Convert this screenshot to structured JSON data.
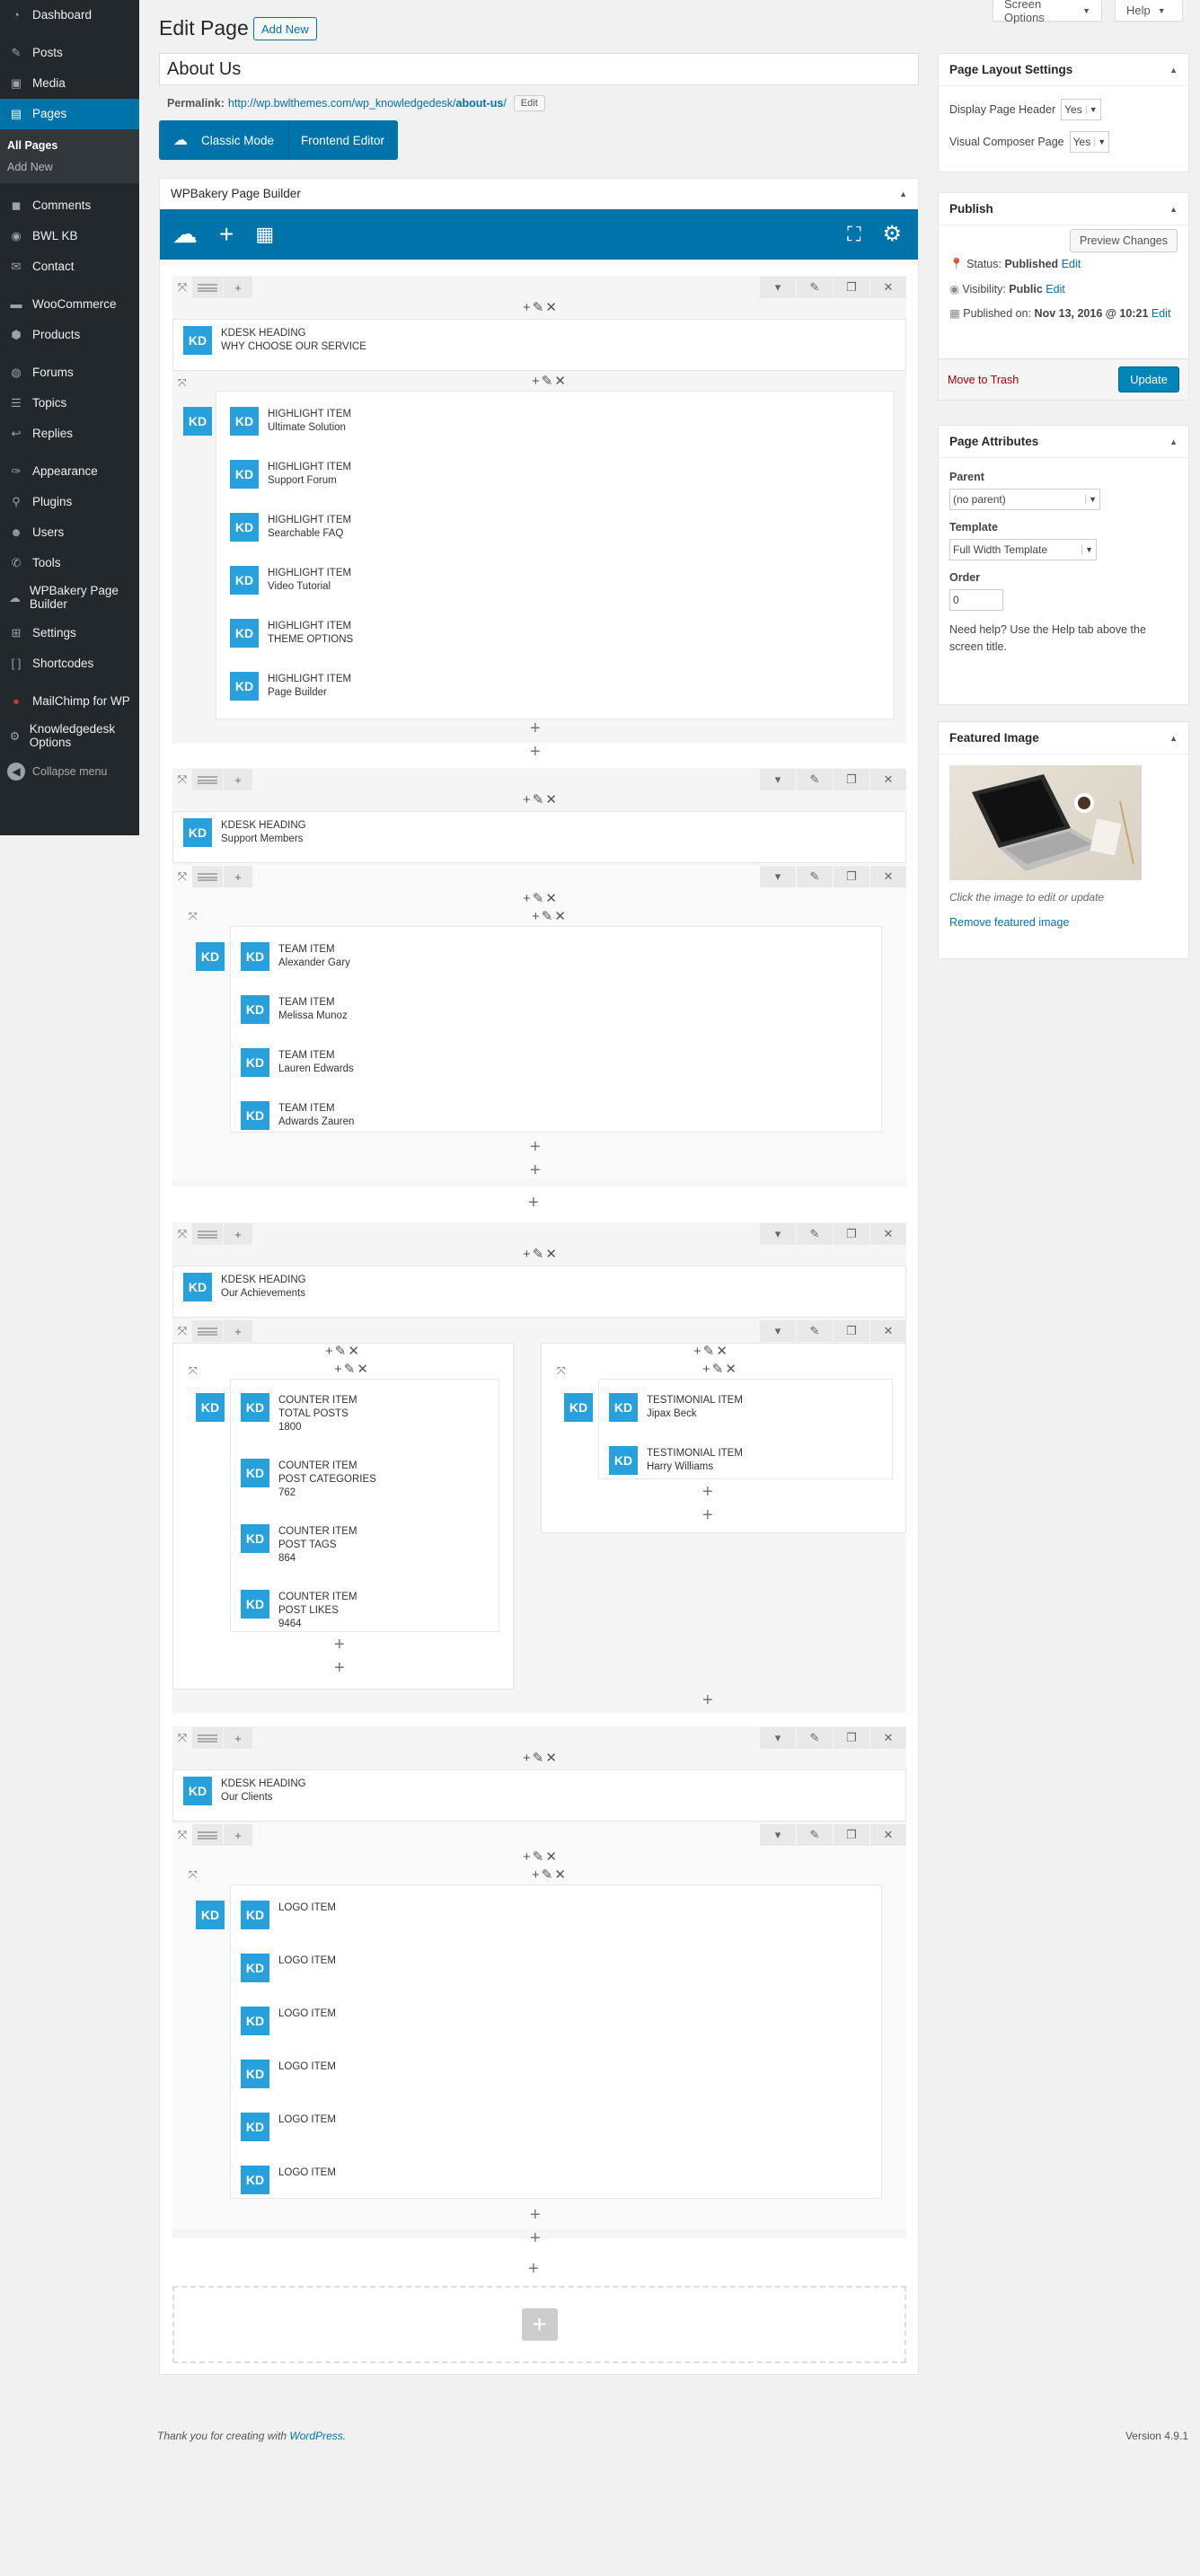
{
  "screen_options": "Screen Options",
  "help": "Help",
  "sidebar": {
    "dashboard": "Dashboard",
    "posts": "Posts",
    "media": "Media",
    "pages": "Pages",
    "all_pages": "All Pages",
    "add_new": "Add New",
    "comments": "Comments",
    "bwl_kb": "BWL KB",
    "contact": "Contact",
    "woocommerce": "WooCommerce",
    "products": "Products",
    "forums": "Forums",
    "topics": "Topics",
    "replies": "Replies",
    "appearance": "Appearance",
    "plugins": "Plugins",
    "users": "Users",
    "tools": "Tools",
    "wpbakery": "WPBakery Page Builder",
    "settings": "Settings",
    "shortcodes": "Shortcodes",
    "mailchimp": "MailChimp for WP",
    "kd_options": "Knowledgedesk Options",
    "collapse": "Collapse menu"
  },
  "header": {
    "title": "Edit Page",
    "add_new": "Add New",
    "post_title": "About Us",
    "permalink_label": "Permalink:",
    "permalink_base": "http://wp.bwlthemes.com/wp_knowledgedesk/",
    "permalink_slug": "about-us",
    "permalink_end": "/",
    "edit": "Edit",
    "classic_mode": "Classic Mode",
    "frontend_editor": "Frontend Editor"
  },
  "builder": {
    "title": "WPBakery Page Builder",
    "kd": "KD",
    "rows": [
      {
        "heading_name": "KDESK HEADING",
        "heading_sub": "WHY CHOOSE OUR SERVICE",
        "items": [
          {
            "name": "HIGHLIGHT ITEM",
            "sub": "Ultimate Solution"
          },
          {
            "name": "HIGHLIGHT ITEM",
            "sub": "Support Forum"
          },
          {
            "name": "HIGHLIGHT ITEM",
            "sub": "Searchable FAQ"
          },
          {
            "name": "HIGHLIGHT ITEM",
            "sub": "Video Tutorial"
          },
          {
            "name": "HIGHLIGHT ITEM",
            "sub": "THEME OPTIONS"
          },
          {
            "name": "HIGHLIGHT ITEM",
            "sub": "Page Builder"
          }
        ]
      },
      {
        "heading_name": "KDESK HEADING",
        "heading_sub": "Support Members",
        "items": [
          {
            "name": "TEAM ITEM",
            "sub": "Alexander Gary"
          },
          {
            "name": "TEAM ITEM",
            "sub": "Melissa Munoz"
          },
          {
            "name": "TEAM ITEM",
            "sub": "Lauren Edwards"
          },
          {
            "name": "TEAM ITEM",
            "sub": "Adwards Zauren"
          }
        ]
      },
      {
        "heading_name": "KDESK HEADING",
        "heading_sub": "Our Achievements",
        "counters": [
          {
            "name": "COUNTER ITEM",
            "sub": "TOTAL POSTS",
            "val": "1800"
          },
          {
            "name": "COUNTER ITEM",
            "sub": "POST CATEGORIES",
            "val": "762"
          },
          {
            "name": "COUNTER ITEM",
            "sub": "POST TAGS",
            "val": "864"
          },
          {
            "name": "COUNTER ITEM",
            "sub": "POST LIKES",
            "val": "9464"
          }
        ],
        "testimonials": [
          {
            "name": "TESTIMONIAL ITEM",
            "sub": "Jipax Beck"
          },
          {
            "name": "TESTIMONIAL ITEM",
            "sub": "Harry Williams"
          }
        ]
      },
      {
        "heading_name": "KDESK HEADING",
        "heading_sub": "Our Clients",
        "logos": [
          "LOGO ITEM",
          "LOGO ITEM",
          "LOGO ITEM",
          "LOGO ITEM",
          "LOGO ITEM",
          "LOGO ITEM"
        ]
      }
    ]
  },
  "layout_settings": {
    "title": "Page Layout Settings",
    "display_header_label": "Display Page Header",
    "display_header_val": "Yes",
    "vc_page_label": "Visual Composer Page",
    "vc_page_val": "Yes"
  },
  "publish": {
    "title": "Publish",
    "preview": "Preview Changes",
    "status_label": "Status:",
    "status_val": "Published",
    "visibility_label": "Visibility:",
    "visibility_val": "Public",
    "published_label": "Published on:",
    "published_val": "Nov 13, 2016 @ 10:21",
    "edit": "Edit",
    "trash": "Move to Trash",
    "update": "Update"
  },
  "attributes": {
    "title": "Page Attributes",
    "parent_label": "Parent",
    "parent_val": "(no parent)",
    "template_label": "Template",
    "template_val": "Full Width Template",
    "order_label": "Order",
    "order_val": "0",
    "help": "Need help? Use the Help tab above the screen title."
  },
  "featured": {
    "title": "Featured Image",
    "hint": "Click the image to edit or update",
    "remove": "Remove featured image"
  },
  "footer": {
    "thanks": "Thank you for creating with",
    "wp": "WordPress",
    "dot": ".",
    "version": "Version 4.9.1"
  }
}
